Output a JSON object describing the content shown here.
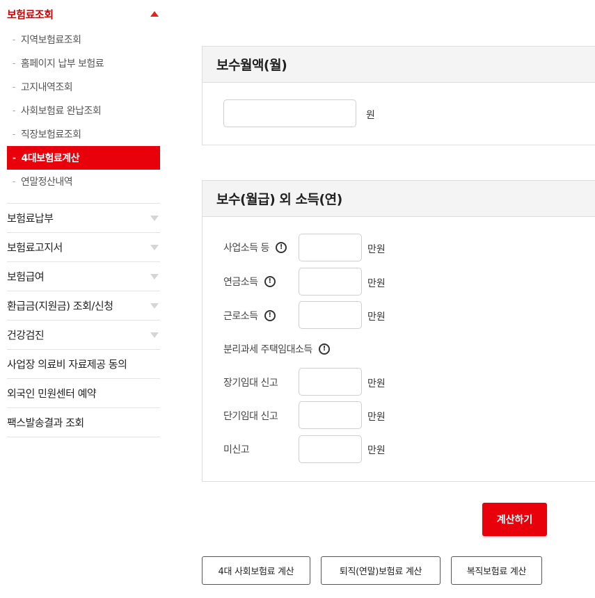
{
  "sidebar": {
    "header": "보험료조회",
    "subitems": [
      "지역보험료조회",
      "홈페이지 납부 보험료",
      "고지내역조회",
      "사회보험료 완납조회",
      "직장보험료조회",
      "4대보험료계산",
      "연말정산내역"
    ],
    "active_subitem": "4대보험료계산",
    "items": [
      "보험료납부",
      "보험료고지서",
      "보험급여",
      "환급금(지원금) 조회/신청",
      "건강검진",
      "사업장 의료비 자료제공 동의",
      "외국인 민원센터 예약",
      "팩스발송결과 조회"
    ],
    "accent_color": "#e8000b"
  },
  "salary_panel": {
    "title": "보수월액(월)",
    "value": "",
    "unit": "원"
  },
  "income_panel": {
    "title": "보수(월급) 외 소득(연)",
    "rows": [
      {
        "label": "사업소득 등",
        "unit": "만원",
        "value": ""
      },
      {
        "label": "연금소득",
        "unit": "만원",
        "value": ""
      },
      {
        "label": "근로소득",
        "unit": "만원",
        "value": ""
      }
    ],
    "section_label": "분리과세 주택임대소득",
    "rental_rows": [
      {
        "label": "장기임대 신고",
        "unit": "만원",
        "value": ""
      },
      {
        "label": "단기임대 신고",
        "unit": "만원",
        "value": ""
      },
      {
        "label": "미신고",
        "unit": "만원",
        "value": ""
      }
    ]
  },
  "buttons": {
    "calculate": "계산하기",
    "social_insurance": "4대 사회보험료 계산",
    "retirement": "퇴직(연말)보험료 계산",
    "reinstatement": "복직보험료 계산"
  }
}
